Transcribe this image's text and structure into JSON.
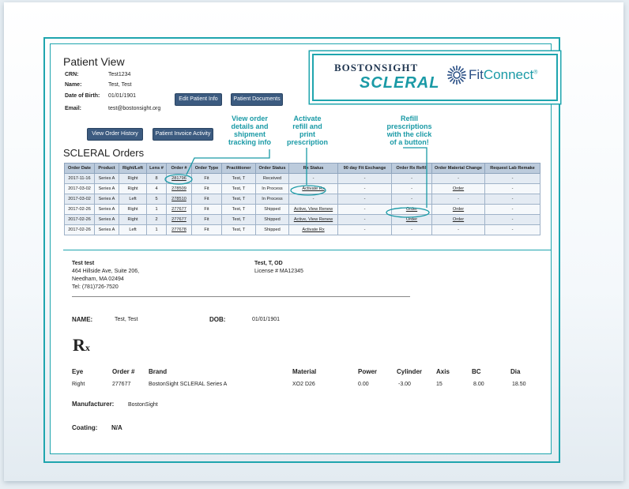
{
  "page_title": "Patient View",
  "patient": {
    "crn_label": "CRN:",
    "crn": "Test1234",
    "name_label": "Name:",
    "name": "Test, Test",
    "dob_label": "Date of Birth:",
    "dob": "01/01/1901",
    "email_label": "Email:",
    "email": "test@bostonsight.org"
  },
  "buttons": {
    "edit_patient": "Edit Patient Info",
    "patient_documents": "Patient Documents",
    "order_history": "View Order History",
    "invoice_activity": "Patient Invoice Activity"
  },
  "orders_title": "SCLERAL Orders",
  "table": {
    "headers": [
      "Order Date",
      "Product",
      "Right/Left",
      "Lens #",
      "Order #",
      "Order Type",
      "Practitioner",
      "Order Status",
      "Rx Status",
      "90 day Fit Exchange",
      "Order Rx Refill",
      "Order Material Change",
      "Request Lab Remake"
    ],
    "rows": [
      [
        "2017-11-16",
        "Series A",
        "Right",
        "8",
        "281796",
        "Fit",
        "Test, T",
        "Received",
        "-",
        "-",
        "-",
        "-",
        "-"
      ],
      [
        "2017-03-02",
        "Series A",
        "Right",
        "4",
        "278509",
        "Fit",
        "Test, T",
        "In Process",
        "Activate Rx",
        "-",
        "-",
        "Order",
        "-"
      ],
      [
        "2017-03-02",
        "Series A",
        "Left",
        "5",
        "278510",
        "Fit",
        "Test, T",
        "In Process",
        "-",
        "-",
        "-",
        "-",
        "-"
      ],
      [
        "2017-02-26",
        "Series A",
        "Right",
        "1",
        "277677",
        "Fit",
        "Test, T",
        "Shipped",
        "Active, View Renew",
        "-",
        "Order",
        "Order",
        "-"
      ],
      [
        "2017-02-26",
        "Series A",
        "Right",
        "2",
        "277677",
        "Fit",
        "Test, T",
        "Shipped",
        "Active, View Renew",
        "-",
        "Order",
        "Order",
        "-"
      ],
      [
        "2017-02-26",
        "Series A",
        "Left",
        "1",
        "277678",
        "Fit",
        "Test, T",
        "Shipped",
        "Activate Rx",
        "-",
        "-",
        "-",
        "-"
      ]
    ]
  },
  "annotations": {
    "a1": [
      "View order",
      "details and",
      "shipment",
      "tracking info"
    ],
    "a2": [
      "Activate",
      "refill and",
      "print",
      "prescription"
    ],
    "a3": [
      "Refill",
      "prescriptions",
      "with the click",
      "of a button!"
    ]
  },
  "logos": {
    "bostonsight": "BOSTONSIGHT",
    "scleral": "SCLERAL",
    "fitconnect_fit": "Fit",
    "fitconnect_connect": "Connect"
  },
  "rx": {
    "patient_name": "Test test",
    "addr1": "464 Hillside Ave, Suite 206,",
    "addr2": "Needham, MA 02494",
    "phone": "Tel: (781)726-7520",
    "doctor": "Test, T, OD",
    "license": "License # MA12345",
    "name_label": "NAME:",
    "name": "Test, Test",
    "dob_label": "DOB:",
    "dob": "01/01/1901",
    "symbol": "R",
    "columns": [
      "Eye",
      "Order #",
      "Brand",
      "Material",
      "Power",
      "Cylinder",
      "Axis",
      "BC",
      "Dia"
    ],
    "values": [
      "Right",
      "277677",
      "BostonSight SCLERAL Series A",
      "XO2 D26",
      "0.00",
      "-3.00",
      "15",
      "8.00",
      "18.50"
    ],
    "manufacturer_label": "Manufacturer:",
    "manufacturer": "BostonSight",
    "coating_label": "Coating:",
    "coating": "N/A"
  },
  "colors": {
    "accent": "#1fa5ae",
    "button": "#3c5b80",
    "header": "#bccbdc"
  }
}
